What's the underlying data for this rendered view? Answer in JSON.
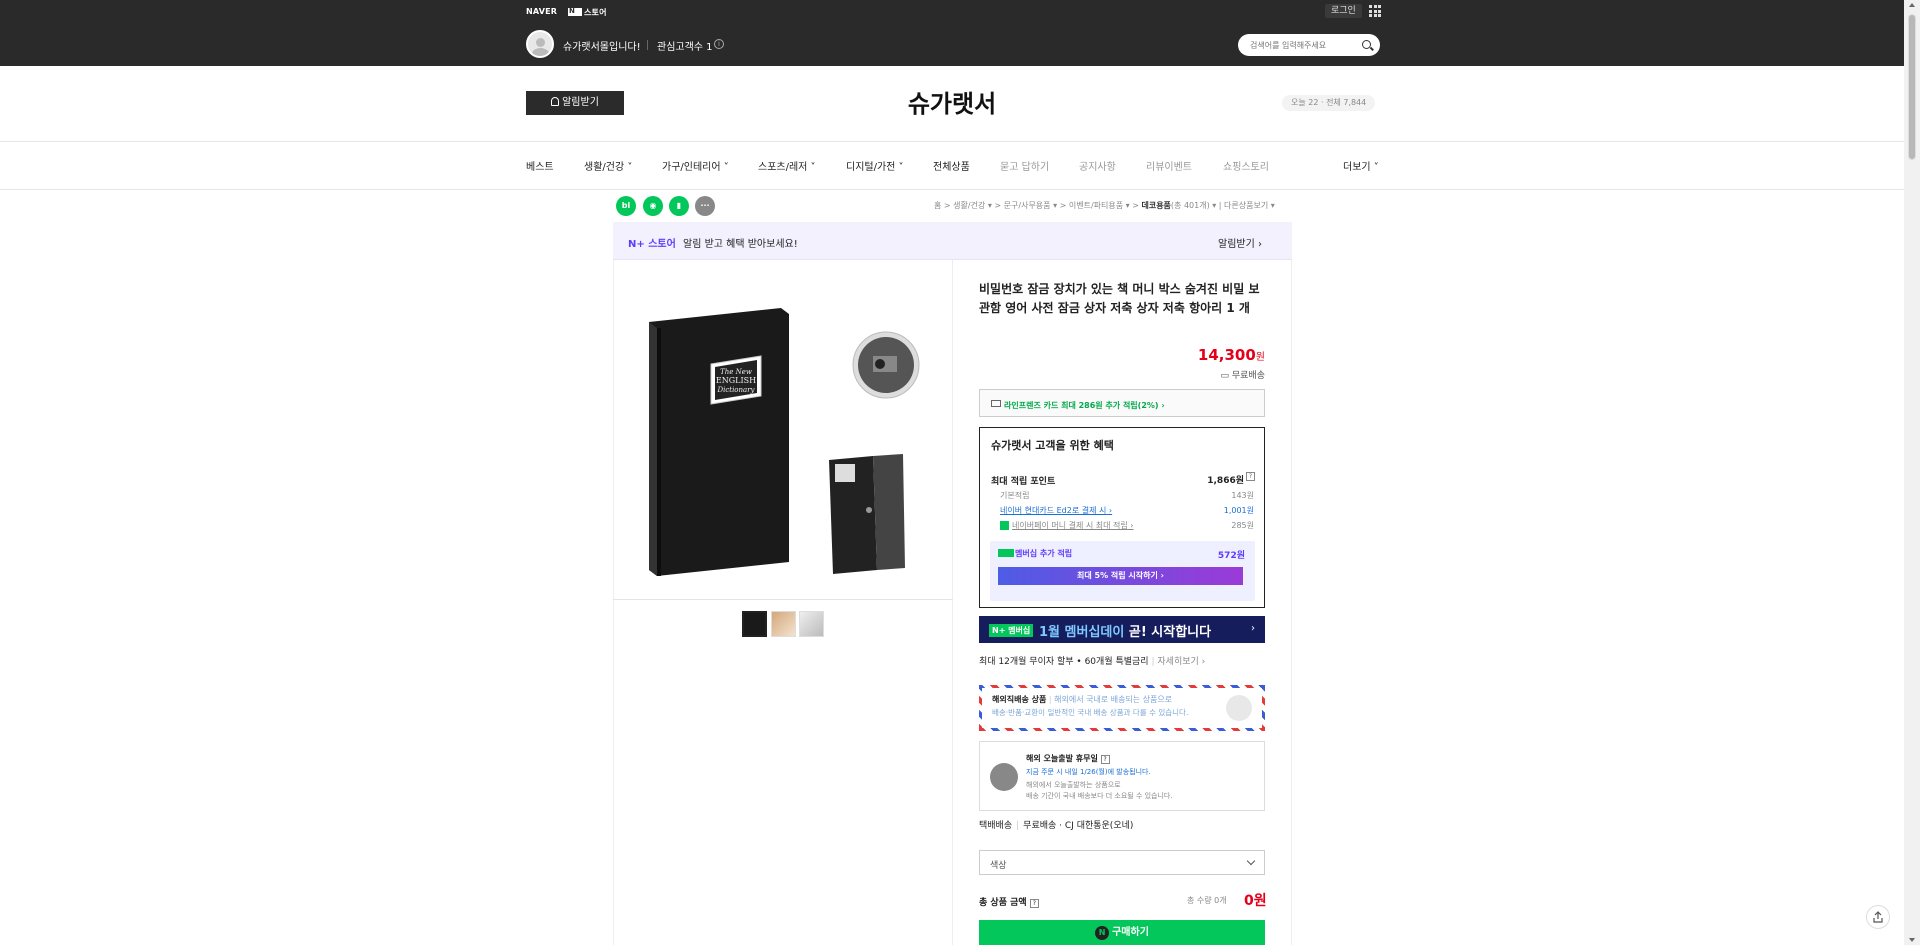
{
  "topbar": {
    "naver": "NAVER",
    "npay_store": "스토어",
    "login": "로그인",
    "store_greeting": "슈가랫서몰입니다!",
    "fav_count": "관심고객수 1",
    "search_placeholder": "검색어를 입력해주세요"
  },
  "header": {
    "alert_button": "알림받기",
    "store_title": "슈가랫서",
    "visitor": "오늘 22 · 전체 7,844"
  },
  "nav": {
    "items": [
      "베스트",
      "생활/건강",
      "가구/인테리어",
      "스포츠/레저",
      "디지털/가전",
      "전체상품",
      "묻고 답하기",
      "공지사항",
      "리뷰이벤트",
      "쇼핑스토리",
      "더보기"
    ]
  },
  "sns": [
    "bl",
    "",
    "",
    "···"
  ],
  "breadcrumb": {
    "items": [
      "홈",
      "생활/건강",
      "문구/사무용품",
      "이벤트/파티용품",
      "데코용품",
      "(총 401개)",
      "다른상품보기"
    ]
  },
  "notice": {
    "brand": "N+ 스토어",
    "text": "알림 받고 혜택 받아보세요!",
    "link": "알림받기"
  },
  "product": {
    "title": "비밀번호 잠금 장치가 있는 책 머니 박스 숨겨진 비밀 보관함 영어 사전 잠금 상자 저축 상자 저축 항아리 1 개",
    "price": "14,300",
    "price_unit": "원",
    "shipping": "무료배송",
    "card_benefit": "라인프렌즈 카드 최대 286원 추가 적립(2%)",
    "book_cover": "The New ENGLISH Dictionary"
  },
  "benefits": {
    "title": "슈가랫서 고객을 위한 혜택",
    "rows": [
      {
        "label": "최대 적립 포인트",
        "value": "1,866원"
      },
      {
        "label": "기본적립",
        "value": "143원"
      },
      {
        "label": "네이버 현대카드 Ed2로 결제 시",
        "value": "1,001원"
      },
      {
        "label": "네이버페이 머니 결제 시 최대 적립",
        "value": "285원"
      }
    ],
    "member_label": "멤버십 추가 적립",
    "member_value": "572원",
    "member_button": "최대 5% 적립 시작하기"
  },
  "banner": {
    "badge": "N+ 멤버십",
    "title_a": "1월 멤버십데이",
    "title_b": "곧! 시작합니다"
  },
  "installment": {
    "text": "최대 12개월 무이자 할부 • 60개월 특별금리",
    "more": "자세히보기"
  },
  "overseas": {
    "title": "해외직배송 상품",
    "line1": "해외에서 국내로 배송되는 상품으로",
    "line2": "배송·반품·교환이 일반적인 국내 배송 상품과 다를 수 있습니다."
  },
  "ship": {
    "title": "해외 오늘출발 휴무일",
    "line1": "지금 주문 시 내일 1/26(월)에 발송됩니다.",
    "line2": "해외에서 오늘출발하는 상품으로",
    "line3": "배송 기간이 국내 배송보다 더 소요될 수 있습니다."
  },
  "delivery": {
    "label": "택배배송",
    "fee": "무료배송",
    "carrier": "CJ 대한통운(오네)"
  },
  "option": {
    "placeholder": "색상"
  },
  "total": {
    "label": "총 상품 금액",
    "qty": "총 수량 0개",
    "price": "0원"
  },
  "buy": {
    "label": "구매하기"
  }
}
